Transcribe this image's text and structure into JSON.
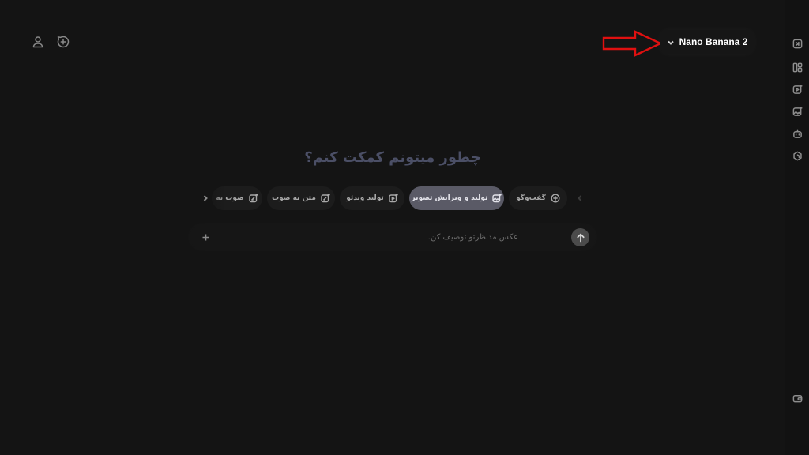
{
  "header": {
    "account_icon": "user-icon",
    "new_chat_icon": "plus-circle-icon",
    "model_selector": {
      "label": "Nano Banana 2",
      "chevron_icon": "chevron-down-icon"
    }
  },
  "annotation": {
    "color": "#e01010",
    "icon": "arrow-right-icon"
  },
  "right_rail": {
    "items": [
      {
        "icon": "new-window-icon"
      },
      {
        "icon": "layout-icon"
      },
      {
        "icon": "video-sparkle-icon"
      },
      {
        "icon": "image-sparkle-icon"
      },
      {
        "icon": "robot-icon"
      },
      {
        "icon": "puzzle-icon"
      }
    ],
    "bottom_icon": "wallet-icon"
  },
  "main": {
    "heading": "چطور میتونم کمکت کنم؟",
    "modes": [
      {
        "label": "گفت‌وگو",
        "icon": "plus-circle-icon",
        "active": false
      },
      {
        "label": "تولید و ویرایش تصویر",
        "icon": "image-sparkle-icon",
        "active": true
      },
      {
        "label": "تولید ویدئو",
        "icon": "video-sparkle-icon",
        "active": false
      },
      {
        "label": "متن به صوت",
        "icon": "edit-sparkle-icon",
        "active": false
      },
      {
        "label": "صوت به",
        "icon": "edit-sparkle-icon",
        "active": false
      }
    ],
    "prompt": {
      "placeholder": "عکس مدنظرتو توصیف کن...",
      "value": "",
      "send_icon": "arrow-up-icon",
      "attach_icon": "plus-icon"
    }
  },
  "colors": {
    "background": "#141414",
    "active_chip": "#5a5a66",
    "heading": "#4b4f66"
  }
}
